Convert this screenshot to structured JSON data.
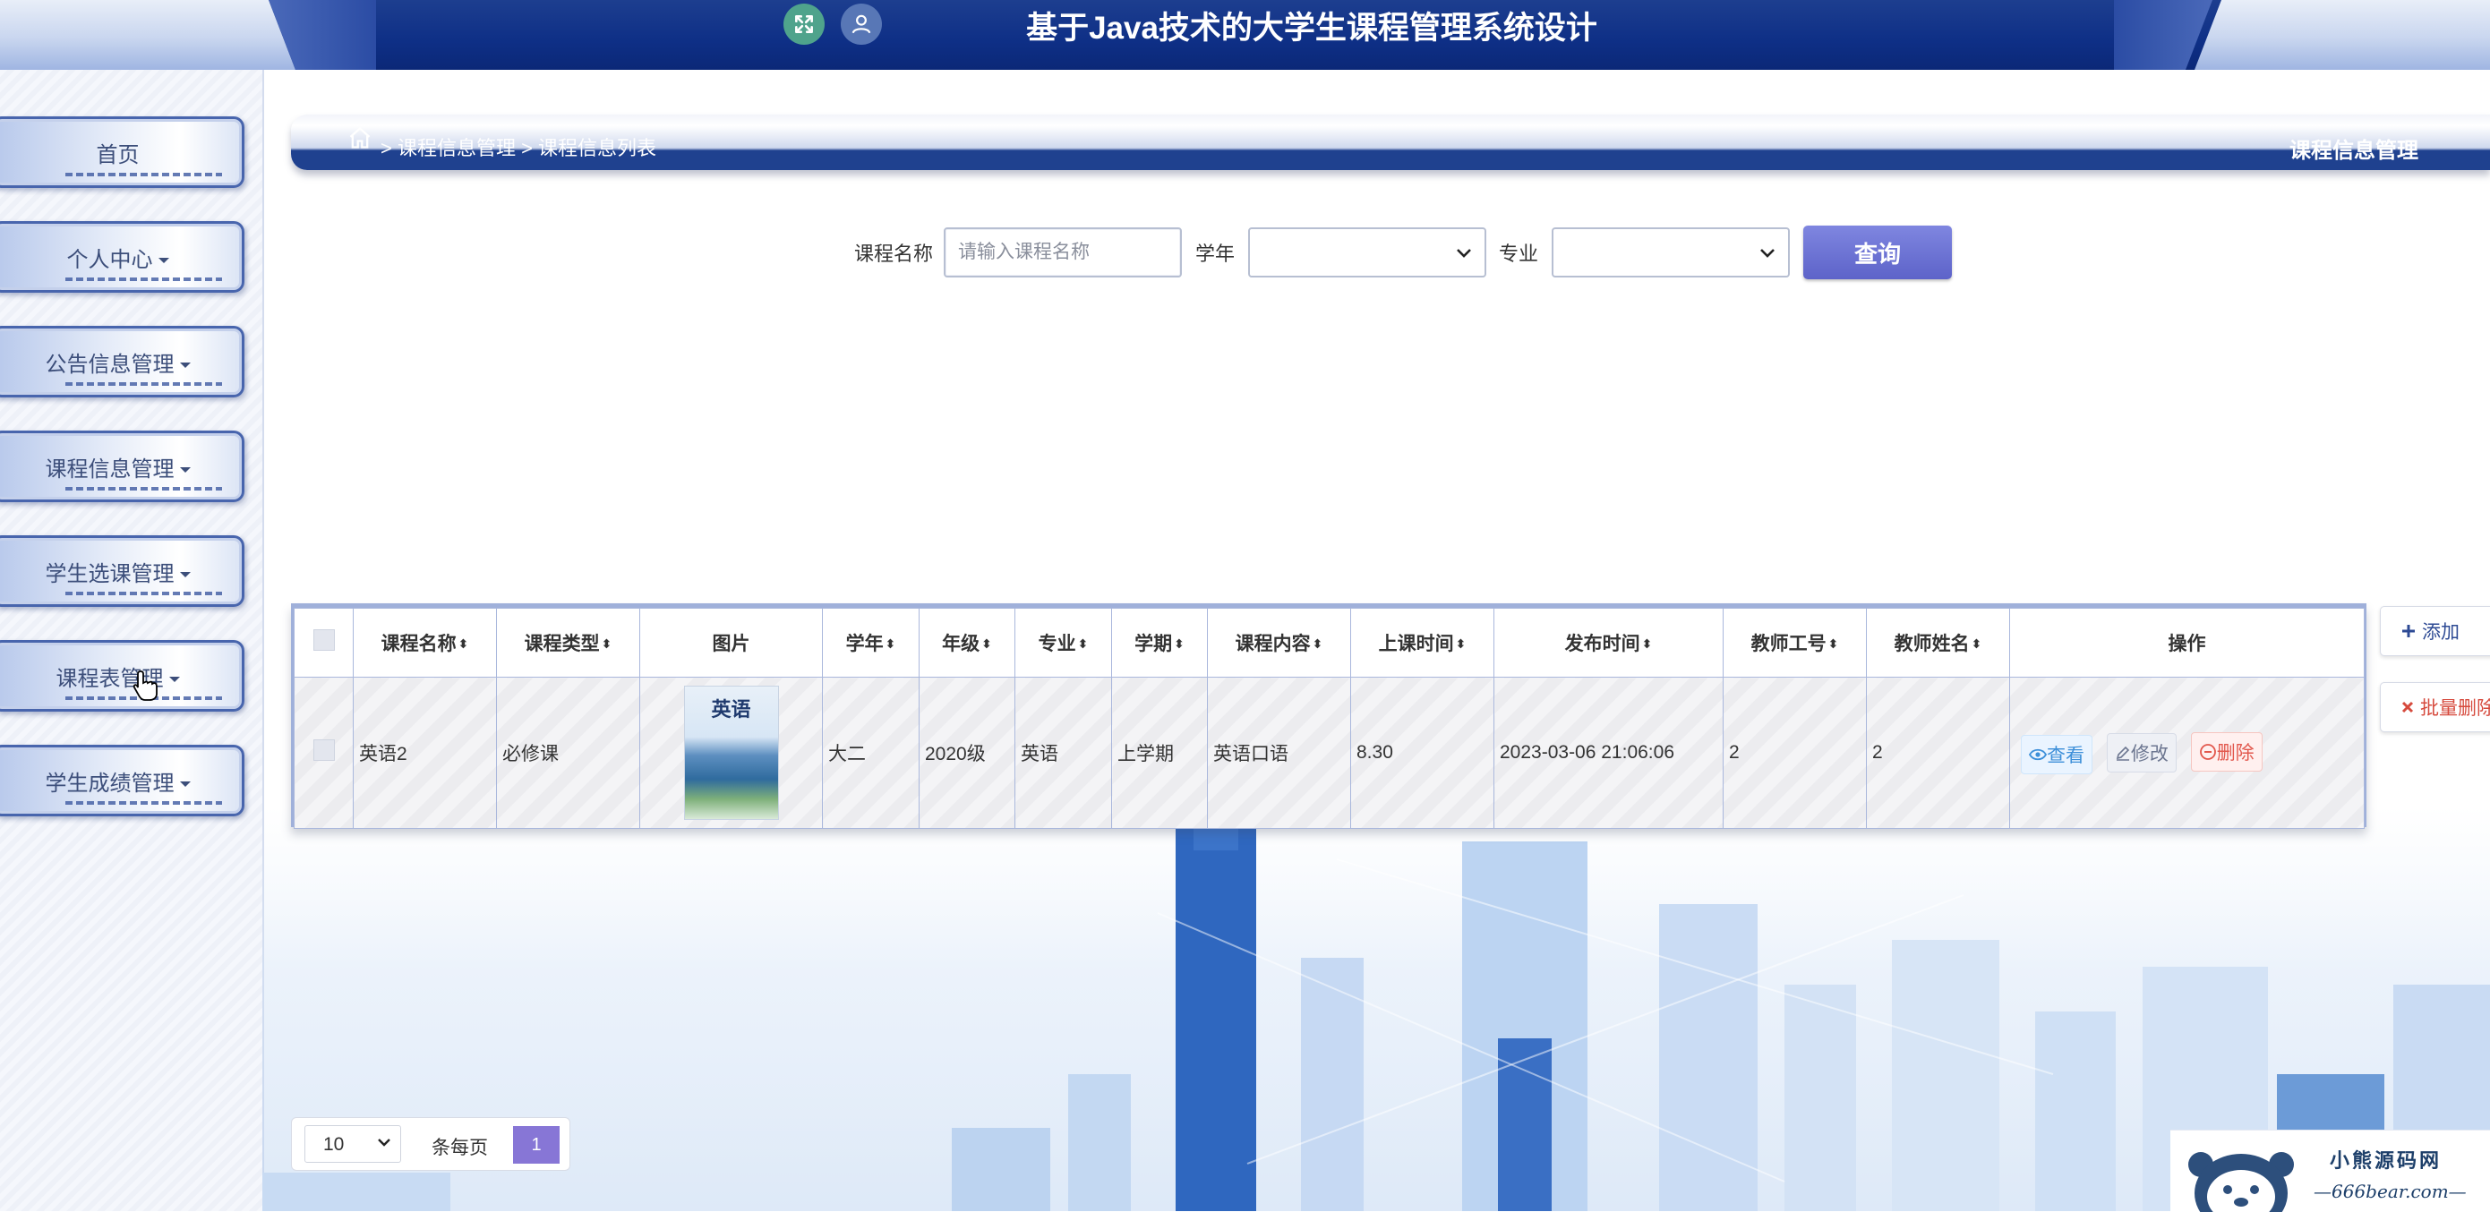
{
  "header": {
    "title": "基于Java技术的大学生课程管理系统设计",
    "icons": [
      "fullscreen-icon",
      "user-icon"
    ]
  },
  "sidebar": {
    "items": [
      {
        "label": "首页",
        "has_caret": false
      },
      {
        "label": "个人中心",
        "has_caret": true
      },
      {
        "label": "公告信息管理",
        "has_caret": true
      },
      {
        "label": "课程信息管理",
        "has_caret": true
      },
      {
        "label": "学生选课管理",
        "has_caret": true
      },
      {
        "label": "课程表管理",
        "has_caret": true
      },
      {
        "label": "学生成绩管理",
        "has_caret": true
      }
    ]
  },
  "breadcrumb": {
    "text": "> 课程信息管理 > 课程信息列表",
    "page_title": "课程信息管理"
  },
  "search": {
    "course_name_label": "课程名称",
    "course_name_placeholder": "请输入课程名称",
    "course_name_value": "",
    "year_label": "学年",
    "year_value": "",
    "major_label": "专业",
    "major_value": "",
    "button_label": "查询"
  },
  "table": {
    "columns": [
      "课程名称",
      "课程类型",
      "图片",
      "学年",
      "年级",
      "专业",
      "学期",
      "课程内容",
      "上课时间",
      "发布时间",
      "教师工号",
      "教师姓名",
      "操作"
    ],
    "rows": [
      {
        "course_name": "英语2",
        "course_type": "必修课",
        "image_text": "英语",
        "school_year": "大二",
        "grade": "2020级",
        "major": "英语",
        "term": "上学期",
        "content": "英语口语",
        "class_time": "8.30",
        "publish_time": "2023-03-06 21:06:06",
        "teacher_id": "2",
        "teacher_name": "2"
      }
    ],
    "actions": {
      "view": "查看",
      "edit": "修改",
      "delete": "删除"
    }
  },
  "side_buttons": {
    "add": "添加",
    "batch_delete": "批量删除"
  },
  "pagination": {
    "page_size": "10",
    "per_page_label": "条每页",
    "current_page": "1"
  },
  "watermark": {
    "title": "小熊源码网",
    "url": "—666bear.com—"
  },
  "colors": {
    "header_bg": "#0e2f86",
    "accent": "#5d63c9",
    "page_active": "#8776d6",
    "delete_red": "#e2574c",
    "view_blue": "#3d8fd9"
  }
}
